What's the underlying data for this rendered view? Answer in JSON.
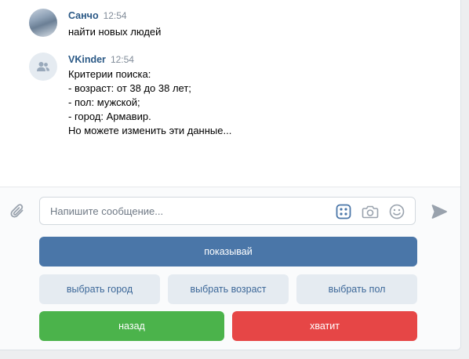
{
  "messages": [
    {
      "author": "Санчо",
      "time": "12:54",
      "lines": [
        "найти новых людей"
      ],
      "avatar": "user-photo-avatar"
    },
    {
      "author": "VKinder",
      "time": "12:54",
      "lines": [
        "Критерии поиска:",
        "- возраст: от 38 до 38 лет;",
        "- пол: мужской;",
        "- город: Армавир.",
        "",
        "Но можете изменить эти данные..."
      ],
      "avatar": "group-icon"
    }
  ],
  "composer": {
    "placeholder": "Напишите сообщение...",
    "icons": [
      "paperclip-icon",
      "keyboard-icon",
      "camera-icon",
      "smile-icon",
      "send-icon"
    ]
  },
  "keyboard": {
    "rows": [
      [
        {
          "label": "показывай",
          "color": "primary"
        }
      ],
      [
        {
          "label": "выбрать город",
          "color": "secondary"
        },
        {
          "label": "выбрать возраст",
          "color": "secondary"
        },
        {
          "label": "выбрать пол",
          "color": "secondary"
        }
      ],
      [
        {
          "label": "назад",
          "color": "positive"
        },
        {
          "label": "хватит",
          "color": "negative"
        }
      ]
    ]
  },
  "colors": {
    "link": "#2a5885",
    "primary": "#4a76a8",
    "secondary": "#e5ebf1",
    "positive": "#4bb34b",
    "negative": "#e64646"
  }
}
